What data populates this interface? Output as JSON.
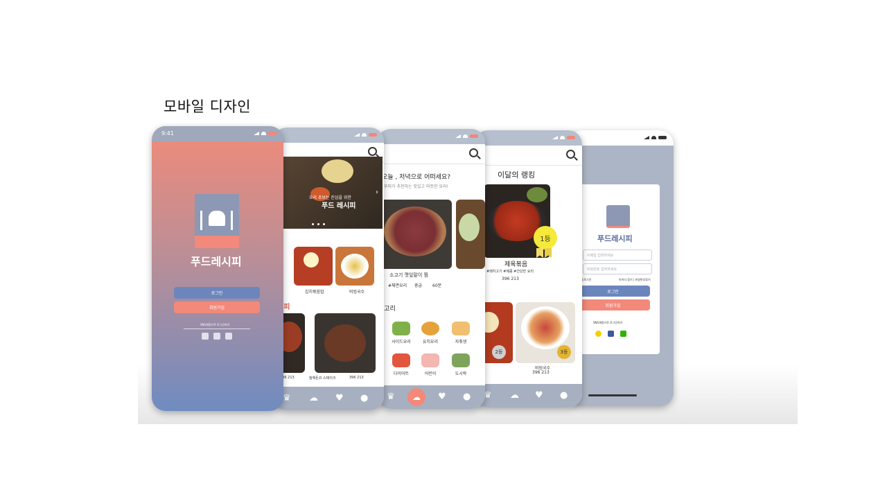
{
  "slide": {
    "title": "모바일 디자인"
  },
  "status": {
    "time": "9:41"
  },
  "splash": {
    "app_name": "푸드레시피",
    "login": "로그인",
    "signup": "회원가입",
    "sns_text": "SNS계정으로 로그인하기"
  },
  "home": {
    "banner_line1": "요리 초보는 진심을 위한",
    "banner_line2": "푸드 레시피",
    "recipe_1": "김치볶음밥",
    "recipe_2": "비빔국수",
    "recipe_section": "시피",
    "card_stats_1": "396  213",
    "card_1": "참깨돈코 스테이크",
    "card_stats_2": "396  213"
  },
  "suggest": {
    "question": "오늘 , 저녁으로 어떠세요?",
    "subtitle": "푸피가 추천하는 맛있고 따뜻한 요리!",
    "dish_name": "소고기 깻잎말이 찜",
    "tags": [
      "#체면요리",
      "중급",
      "60분"
    ],
    "category_title": "테고리",
    "categories": [
      "샤브샤브",
      "밥",
      "사이드요리",
      "유치요리",
      "자취생",
      "다이어트",
      "어린이",
      "도시락"
    ]
  },
  "ranking": {
    "title": "이달의 랭킹",
    "badge_top": "이달의 랭킹",
    "badge_rank": "1등",
    "dish_1": "제육볶음",
    "dish_1_desc": "#돼지고기 #매콤 #간단한 요리",
    "dish_1_stats": "396  213",
    "rank_2": "2등",
    "rank_3": "3등",
    "dish_3": "비빔국수",
    "dish_3_stats": "396  213"
  },
  "login": {
    "app_name": "푸드레시피",
    "id_placeholder": "이메일 입력하세요",
    "pw_placeholder": "비밀번호 입력하세요",
    "remember": "자동로그인",
    "find": "아이디 찾기 | 비밀번호찾기",
    "login_btn": "로그인",
    "signup_btn": "회원가입",
    "sns_text": "SNS계정으로 로그인하기"
  },
  "tabs": [
    "crown-icon",
    "chef-hat-icon",
    "heart-icon",
    "user-icon"
  ],
  "colors": {
    "coral": "#f2897a",
    "slate": "#8c98b4",
    "blue": "#6b86bd"
  }
}
